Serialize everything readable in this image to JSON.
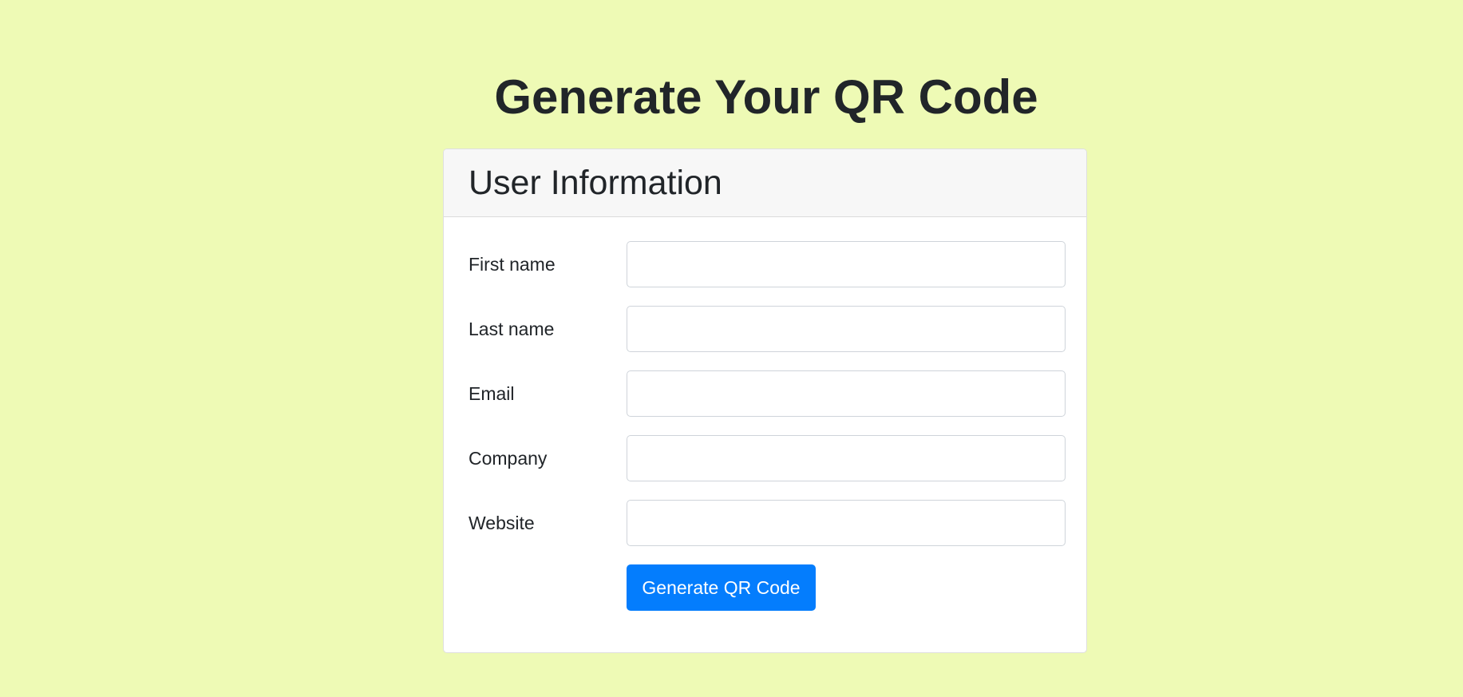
{
  "page": {
    "title": "Generate Your QR Code"
  },
  "card": {
    "title": "User Information"
  },
  "form": {
    "fields": [
      {
        "label": "First name",
        "value": "",
        "placeholder": ""
      },
      {
        "label": "Last name",
        "value": "",
        "placeholder": ""
      },
      {
        "label": "Email",
        "value": "",
        "placeholder": ""
      },
      {
        "label": "Company",
        "value": "",
        "placeholder": ""
      },
      {
        "label": "Website",
        "value": "",
        "placeholder": ""
      }
    ],
    "submit_label": "Generate QR Code"
  },
  "colors": {
    "background": "#eefab5",
    "card_header": "#f7f7f7",
    "primary_button": "#047dfd",
    "text": "#212529"
  }
}
